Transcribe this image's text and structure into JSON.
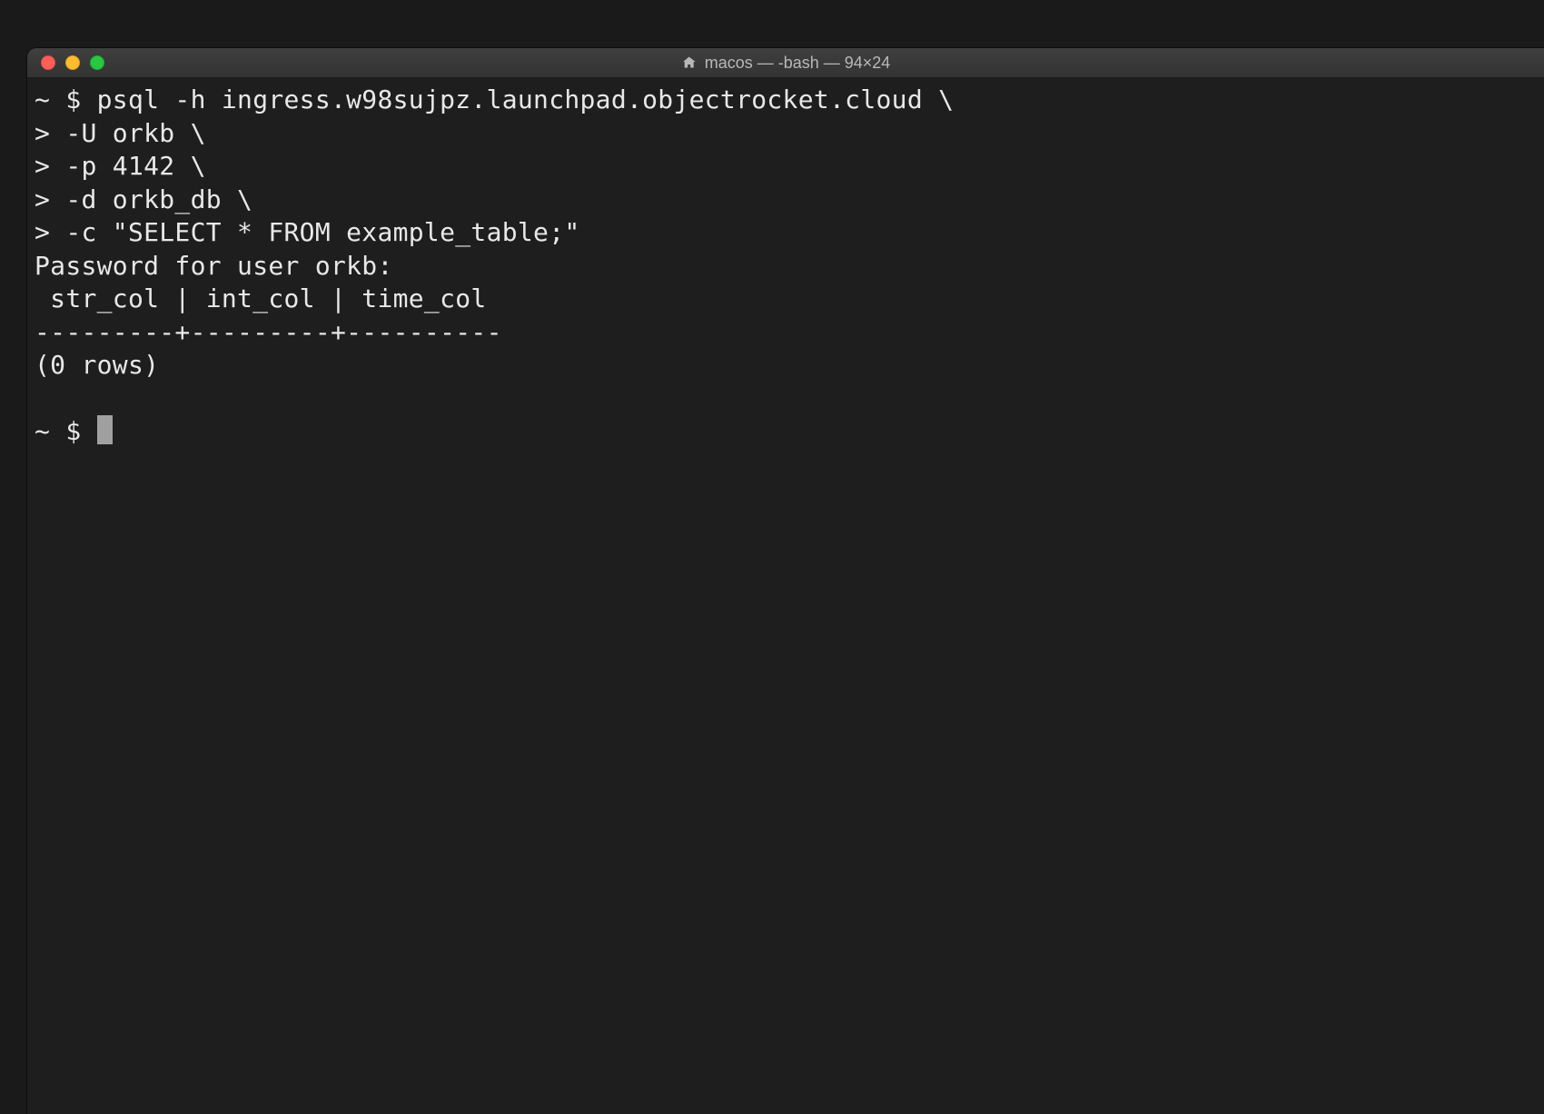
{
  "window": {
    "title": "macos — -bash — 94×24"
  },
  "terminal": {
    "lines": [
      "~ $ psql -h ingress.w98sujpz.launchpad.objectrocket.cloud \\",
      "> -U orkb \\",
      "> -p 4142 \\",
      "> -d orkb_db \\",
      "> -c \"SELECT * FROM example_table;\"",
      "Password for user orkb:",
      " str_col | int_col | time_col",
      "---------+---------+----------",
      "(0 rows)",
      "",
      "~ $ "
    ]
  }
}
